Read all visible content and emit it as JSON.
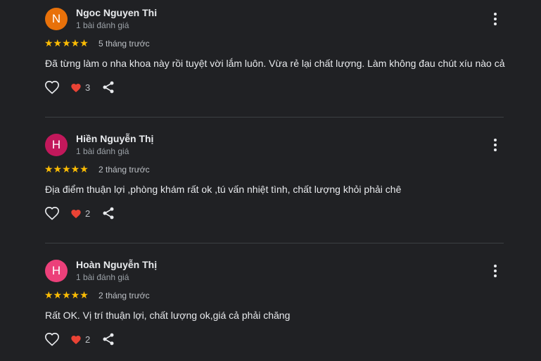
{
  "colors": {
    "background": "#202124",
    "star": "#fbbc04",
    "heart": "#ea4335",
    "divider": "#3c4043"
  },
  "reviews": [
    {
      "initial": "N",
      "avatar_color": "#e8710a",
      "name": "Ngoc Nguyen Thi",
      "review_count": "1 bài đánh giá",
      "stars": "★★★★★",
      "rating": 5,
      "time": "5 tháng trước",
      "text": "Đã từng làm o nha khoa này rồi tuyệt vời lắm luôn. Vừa rẻ lại chất lượng. Làm không đau chút xíu nào cả",
      "reactions": "3"
    },
    {
      "initial": "H",
      "avatar_color": "#c2185b",
      "name": "Hiền Nguyễn Thị",
      "review_count": "1 bài đánh giá",
      "stars": "★★★★★",
      "rating": 5,
      "time": "2 tháng trước",
      "text": "Địa điểm thuận lợi ,phòng khám rất ok ,tú vấn nhiệt tình, chất lượng khỏi phải chê",
      "reactions": "2"
    },
    {
      "initial": "H",
      "avatar_color": "#ec407a",
      "name": "Hoàn Nguyễn Thị",
      "review_count": "1 bài đánh giá",
      "stars": "★★★★★",
      "rating": 5,
      "time": "2 tháng trước",
      "text": "Rất OK. Vị trí thuận lợi, chất lượng ok,giá cả phải chăng",
      "reactions": "2"
    }
  ]
}
